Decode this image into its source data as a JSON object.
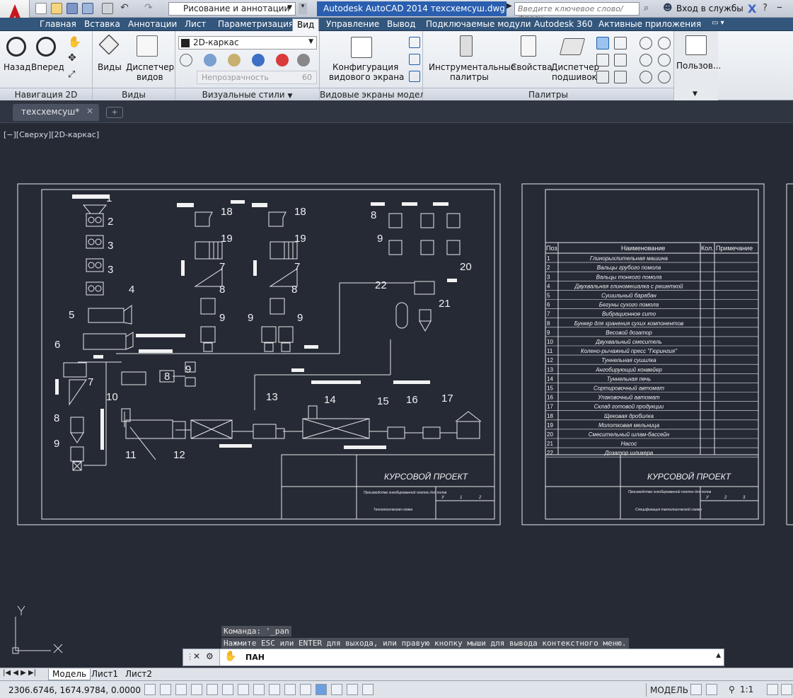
{
  "title_bar": {
    "workspace": "Рисование и аннотации",
    "app_title": "Autodesk AutoCAD 2014    техсхемсуш.dwg",
    "search_placeholder": "Введите ключевое слово/фразу",
    "login": "Вход в службы"
  },
  "ribbon_tabs": [
    "Главная",
    "Вставка",
    "Аннотации",
    "Лист",
    "Параметризация",
    "Вид",
    "Управление",
    "Вывод",
    "Подключаемые модули",
    "Autodesk 360",
    "Активные приложения"
  ],
  "active_tab": "Вид",
  "panels": {
    "nav": {
      "title": "Навигация 2D",
      "back": "Назад",
      "forward": "Вперед"
    },
    "views": {
      "title": "Виды",
      "views": "Виды",
      "manager_1": "Диспетчер",
      "manager_2": "видов"
    },
    "styles": {
      "title": "Визуальные стили",
      "style": "2D-каркас",
      "opacity": "Непрозрачность",
      "opacity_val": "60"
    },
    "viewports": {
      "title": "Видовые экраны модели",
      "config_1": "Конфигурация",
      "config_2": "видового экрана"
    },
    "palettes": {
      "title": "Палитры",
      "tools_1": "Инструментальные",
      "tools_2": "палитры",
      "props": "Свойства",
      "sheetset_1": "Диспетчер",
      "sheetset_2": "подшивок"
    },
    "user": {
      "label": "Пользов..."
    }
  },
  "doc_tab": "техсхемсуш*",
  "viewport_label": "[−][Сверху][2D-каркас]",
  "drawing": {
    "stamp_title": "КУРСОВОЙ ПРОЕКТ",
    "stamp_sub1": "Производство энгобированной плитки для полов",
    "stamp_sub2": "Технологическая схема",
    "stamp_sub3": "Спецификация технологической схемы",
    "cols": [
      "У",
      "1",
      "2"
    ],
    "cols2": [
      "У",
      "2",
      "3"
    ],
    "spec_headers": [
      "Поз.",
      "Наименование",
      "Кол.",
      "Примечание"
    ],
    "spec_rows": [
      "Глинорыхлительная машина",
      "Вальцы грубого помола",
      "Вальцы тонкого помола",
      "Двухвальная глиномешалка с решеткой",
      "Сушильный барабан",
      "Бегуны сухого помола",
      "Вибрационное сито",
      "Бункер для хранения сухих компонентов",
      "Весовой дозатор",
      "Двухвальный смеситель",
      "Колено-рычажный пресс \"Гюрингия\"",
      "Туннельная сушилка",
      "Ангобирующий конвейер",
      "Туннельная печь",
      "Сортировочный автомат",
      "Упаковочный автомат",
      "Склад готовой продукции",
      "Щековая дробилка",
      "Молотковая мельница",
      "Смесительный шлам-бассейн",
      "Насос",
      "Дозатор шликера"
    ]
  },
  "command": {
    "history1": "Команда:  '_pan",
    "history2": "Нажмите ESC или ENTER для выхода, или правую кнопку мыши для вывода контекстного меню.",
    "current": "ПАН"
  },
  "layout_tabs": [
    "Модель",
    "Лист1",
    "Лист2"
  ],
  "status": {
    "coords": "2306.6746, 1674.9784, 0.0000",
    "model": "МОДЕЛЬ",
    "scale": "1:1"
  },
  "colors": {
    "canvas": "#252a35",
    "tab_bar": "#33567c",
    "title": "#2a5fb0",
    "logo": "#c8171e"
  }
}
